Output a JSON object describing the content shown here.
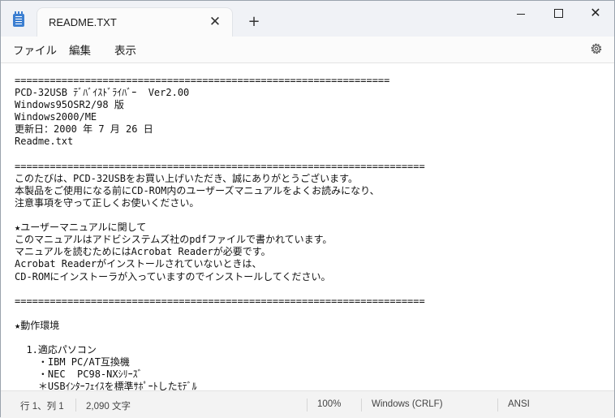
{
  "tab": {
    "title": "README.TXT",
    "close": "✕"
  },
  "new_tab": "+",
  "window_controls": {
    "close": "✕"
  },
  "menu": {
    "file": "ファイル",
    "edit": "編集",
    "view": "表示"
  },
  "icons": {
    "app": "notepad-icon",
    "settings": "gear-icon"
  },
  "document": {
    "lines": [
      "================================================================",
      "PCD-32USB ﾃﾞﾊﾞｲｽﾄﾞﾗｲﾊﾞｰ  Ver2.00",
      "Windows95OSR2/98 版",
      "Windows2000/ME",
      "更新日：2000 年 7 月 26 日",
      "Readme.txt",
      "",
      "======================================================================",
      "このたびは、PCD-32USBをお買い上げいただき、誠にありがとうございます。",
      "本製品をご使用になる前にCD-ROM内のユーザーズマニュアルをよくお読みになり、",
      "注意事項を守って正しくお使いください。",
      "",
      "★ユーザーマニュアルに関して",
      "このマニュアルはアドビシステムズ社のpdfファイルで書かれています。",
      "マニュアルを読むためにはAcrobat Readerが必要です。",
      "Acrobat Readerがインストールされていないときは、",
      "CD-ROMにインストーラが入っていますのでインストールしてください。",
      "",
      "======================================================================",
      "",
      "★動作環境",
      "",
      "  1.適応パソコン",
      "    ・IBM PC/AT互換機",
      "    ・NEC  PC98-NXｼﾘｰｽﾞ",
      "    ＊USBｲﾝﾀｰﾌｪｲｽを標準ｻﾎﾟｰﾄしたﾓﾃﾞﾙ"
    ]
  },
  "status": {
    "position": "行 1、列 1",
    "chars": "2,090 文字",
    "zoom": "100%",
    "line_ending": "Windows (CRLF)",
    "encoding": "ANSI"
  }
}
